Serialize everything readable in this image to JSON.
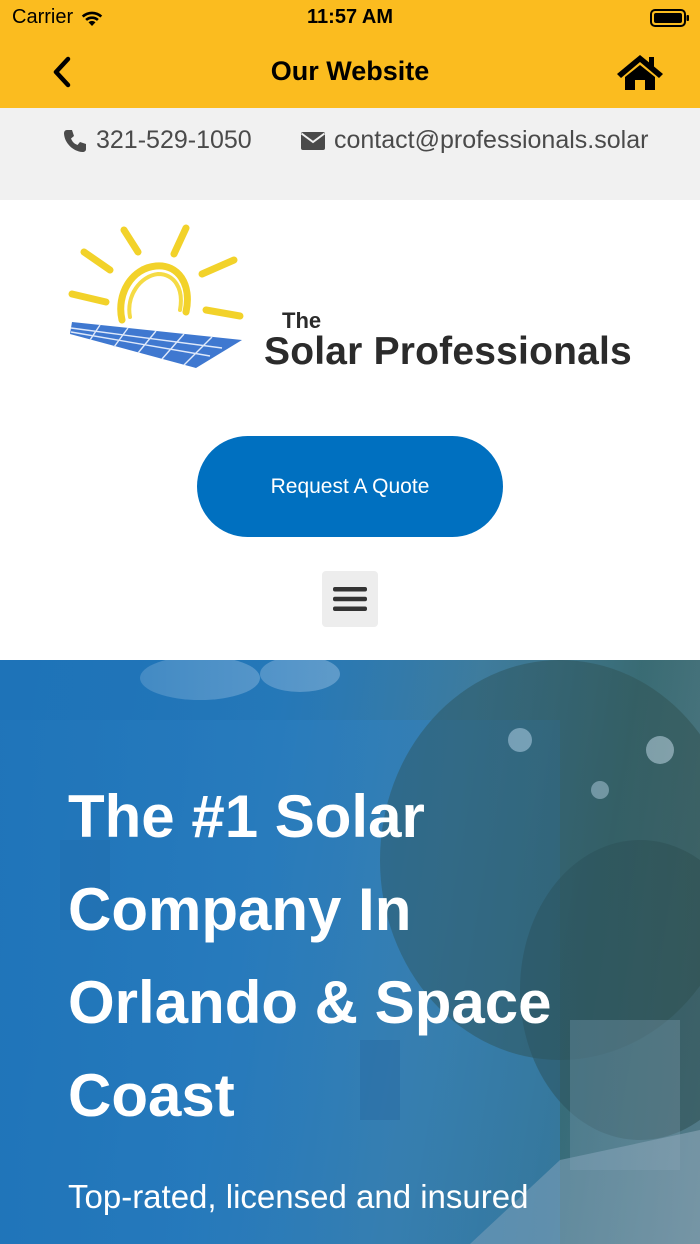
{
  "status_bar": {
    "carrier": "Carrier",
    "time": "11:57 AM"
  },
  "nav": {
    "title": "Our Website",
    "back_icon": "chevron-left-icon",
    "home_icon": "home-icon"
  },
  "contact": {
    "phone": "321-529-1050",
    "email": "contact@professionals.solar",
    "phone_icon": "phone-icon",
    "email_icon": "envelope-icon"
  },
  "logo": {
    "line1": "The",
    "line2": "Solar Professionals"
  },
  "cta": {
    "label": "Request A Quote"
  },
  "menu": {
    "icon": "hamburger-menu-icon"
  },
  "hero": {
    "title": "The #1 Solar Company In Orlando & Space Coast",
    "subtitle": "Top-rated, licensed and insured"
  },
  "colors": {
    "nav_bg": "#FBBC1F",
    "contact_bg": "#F1F1F1",
    "cta_bg": "#0070C0",
    "hero_tint": "#1E73B8"
  }
}
